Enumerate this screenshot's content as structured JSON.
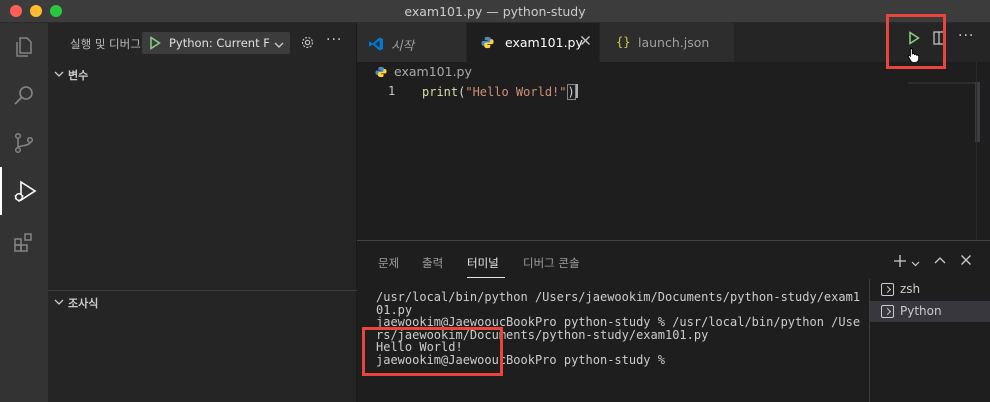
{
  "window": {
    "title": "exam101.py — python-study"
  },
  "activity_bar": {
    "items": [
      {
        "icon": "explorer-icon"
      },
      {
        "icon": "search-icon"
      },
      {
        "icon": "source-control-icon"
      },
      {
        "icon": "run-debug-icon",
        "active": true
      },
      {
        "icon": "extensions-icon"
      }
    ]
  },
  "sidebar": {
    "title": "실행 및 디버그",
    "config": "Python: Current File",
    "sections": {
      "variables": "변수",
      "watch": "조사식"
    }
  },
  "tabs": [
    {
      "label": "시작",
      "icon": "vscode-logo-icon"
    },
    {
      "label": "exam101.py",
      "icon": "python-icon",
      "active": true
    },
    {
      "label": "launch.json",
      "icon": "json-braces-icon"
    }
  ],
  "breadcrumb": {
    "file": "exam101.py"
  },
  "editor": {
    "lines": [
      {
        "number": "1",
        "func": "print",
        "open": "(",
        "string": "\"Hello World!\"",
        "close": ")"
      }
    ]
  },
  "panel": {
    "tabs": [
      "문제",
      "출력",
      "터미널",
      "디버그 콘솔"
    ],
    "active_tab": "터미널",
    "terminal_text": "/usr/local/bin/python /Users/jaewookim/Documents/python-study/exam1\n01.py\njaewookim@JaewooucBookPro python-study % /usr/local/bin/python /Use\nrs/jaewookim/Documents/python-study/exam101.py\nHello World!\njaewookim@JaewooucBookPro python-study % ",
    "terminals": [
      {
        "label": "zsh"
      },
      {
        "label": "Python",
        "selected": true
      }
    ]
  },
  "colors": {
    "annotation": "#e9443d",
    "run": "#89d185",
    "accent": "#0078d4"
  }
}
